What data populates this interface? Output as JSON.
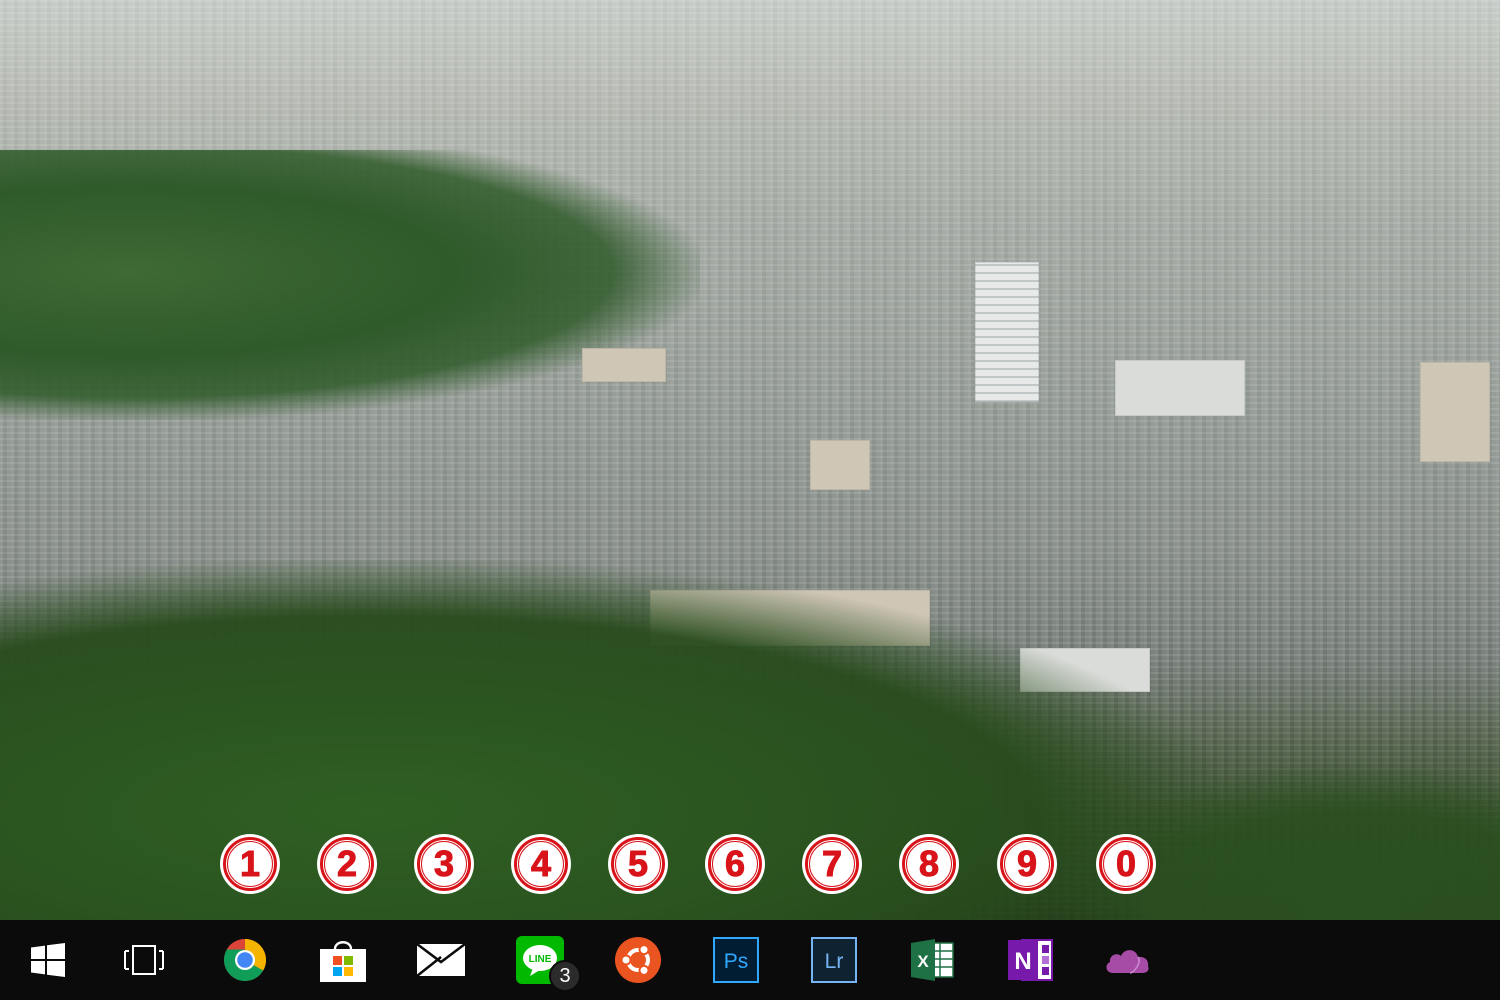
{
  "wallpaper": {
    "scene": "city-valley-with-forest"
  },
  "markers": [
    {
      "label": "1"
    },
    {
      "label": "2"
    },
    {
      "label": "3"
    },
    {
      "label": "4"
    },
    {
      "label": "5"
    },
    {
      "label": "6"
    },
    {
      "label": "7"
    },
    {
      "label": "8"
    },
    {
      "label": "9"
    },
    {
      "label": "0"
    }
  ],
  "taskbar": {
    "items": [
      {
        "icon": "windows-start-icon"
      },
      {
        "icon": "task-view-icon"
      },
      {
        "icon": "chrome-icon"
      },
      {
        "icon": "store-icon"
      },
      {
        "icon": "mail-icon"
      },
      {
        "icon": "line-icon",
        "icon_text": "LINE",
        "badge": "3"
      },
      {
        "icon": "ubuntu-icon"
      },
      {
        "icon": "photoshop-icon",
        "icon_text": "Ps"
      },
      {
        "icon": "lightroom-icon",
        "icon_text": "Lr"
      },
      {
        "icon": "excel-icon",
        "icon_text": "X"
      },
      {
        "icon": "onenote-icon",
        "icon_text": "N"
      },
      {
        "icon": "onedrive-icon"
      }
    ]
  },
  "colors": {
    "taskbar_bg": "#0b0b0b",
    "marker_red": "#d8141a",
    "line_green": "#00b900",
    "ubuntu_orange": "#e95420",
    "photoshop_blue": "#31a8ff",
    "lightroom_blue": "#75b5f3",
    "excel_green": "#1e7145",
    "onenote_purple": "#7719aa",
    "onedrive_purple": "#a64ca6"
  }
}
